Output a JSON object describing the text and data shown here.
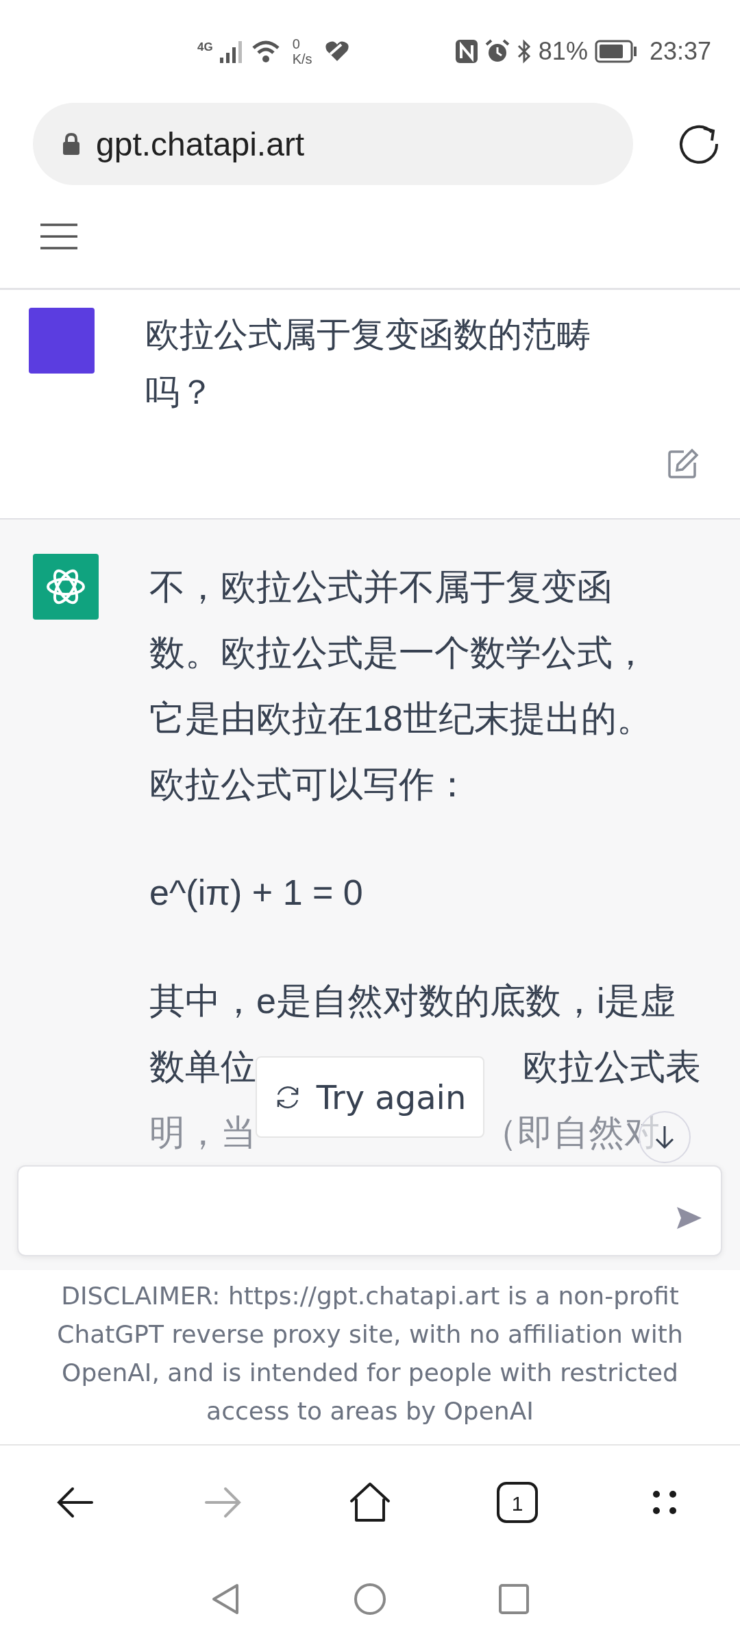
{
  "status_bar": {
    "network": "4G",
    "speed_value": "0",
    "speed_unit": "K/s",
    "battery": "81%",
    "time": "23:37"
  },
  "address_bar": {
    "url": "gpt.chatapi.art"
  },
  "messages": [
    {
      "kind": "user",
      "text": "欧拉公式属于复变函数的范畴吗？"
    },
    {
      "kind": "assistant",
      "paragraphs": [
        "不，欧拉公式并不属于复变函数。欧拉公式是一个数学公式，它是由欧拉在18世纪末提出的。欧拉公式可以写作：",
        "e^(iπ) + 1 = 0"
      ],
      "partial_lines": [
        [
          "其中，e是自然对数的底数，i是虚"
        ],
        [
          "数单位",
          "欧拉公式表"
        ],
        [
          "明，当",
          "（即自然对"
        ]
      ]
    }
  ],
  "popup": {
    "label": "Try again"
  },
  "disclaimer": "DISCLAIMER: https://gpt.chatapi.art is a non-profit ChatGPT reverse proxy site, with no affiliation with OpenAI, and is intended for people with restricted access to areas by OpenAI",
  "browser_nav": [
    {
      "kind": "back",
      "disabled": false
    },
    {
      "kind": "forward",
      "disabled": true
    },
    {
      "kind": "home",
      "disabled": false
    },
    {
      "kind": "tabs",
      "label": "1",
      "disabled": false
    },
    {
      "kind": "menu",
      "disabled": false
    }
  ],
  "system_nav": [
    {
      "kind": "back"
    },
    {
      "kind": "home"
    },
    {
      "kind": "recents"
    }
  ]
}
